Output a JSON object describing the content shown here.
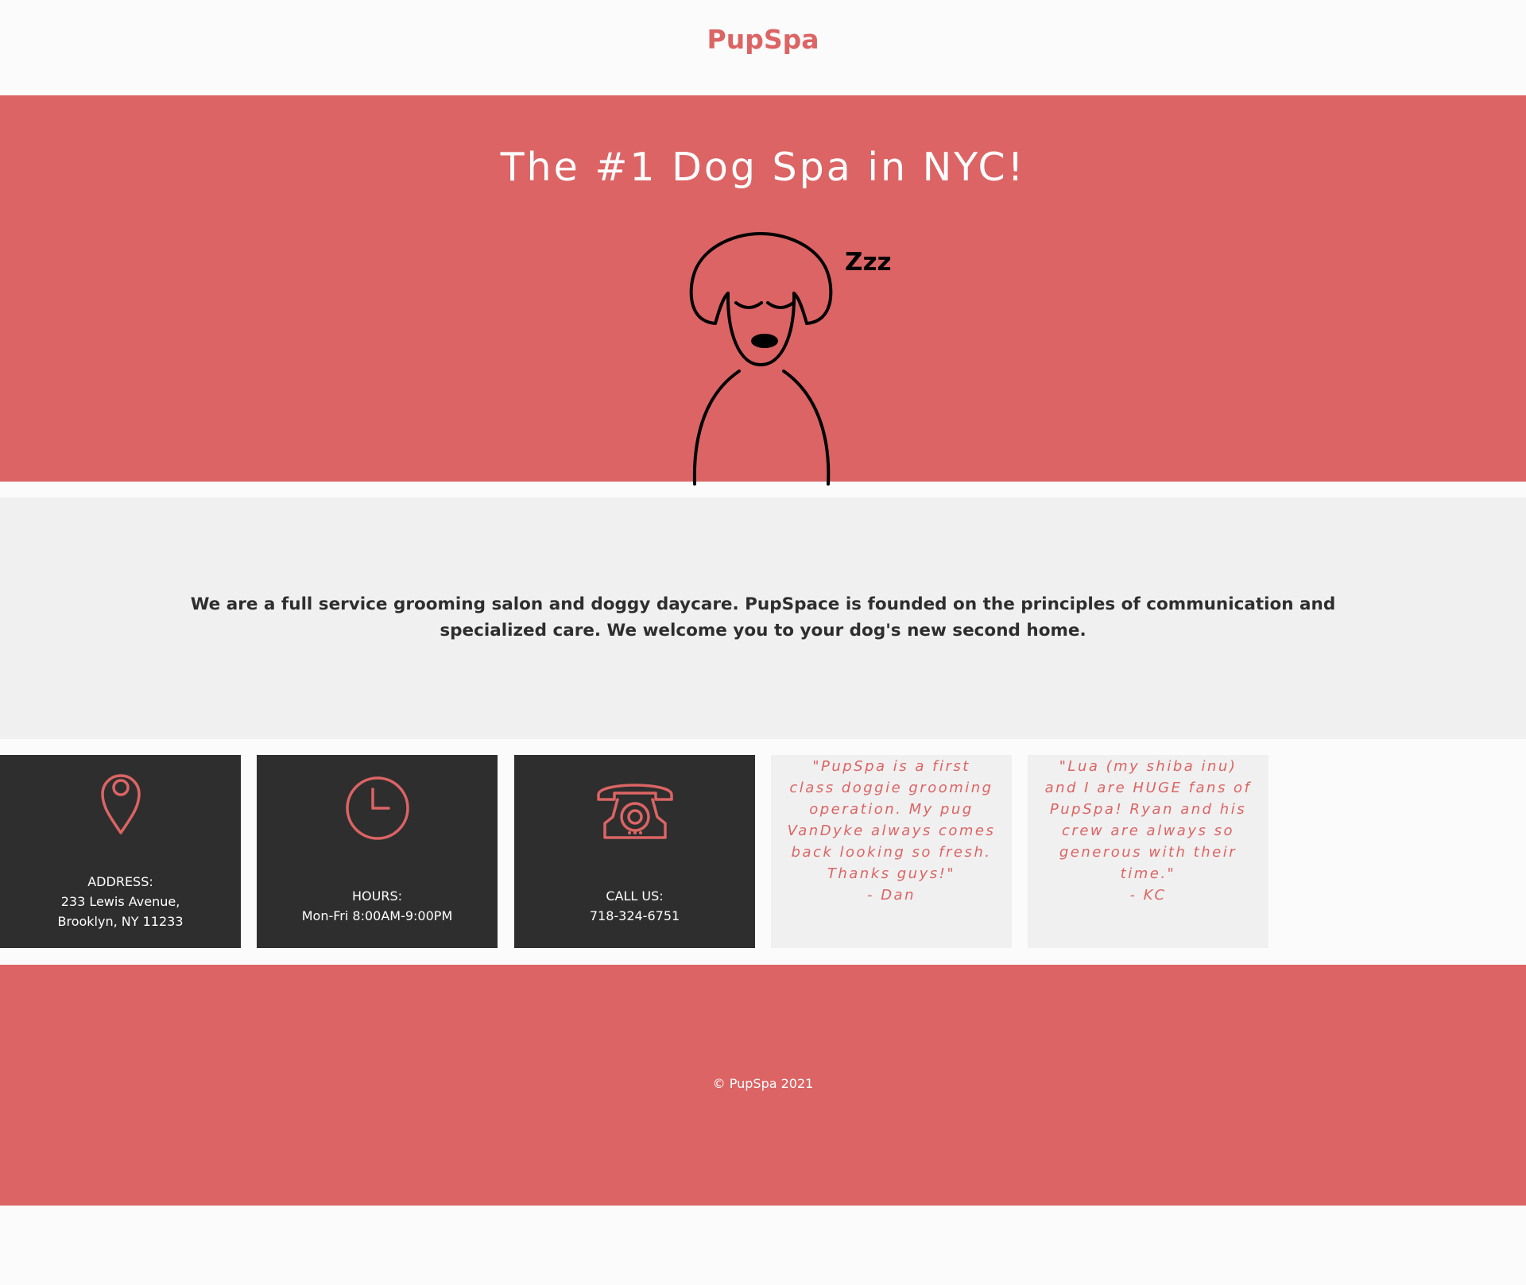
{
  "header": {
    "logo": "PupSpa"
  },
  "hero": {
    "title": "The #1 Dog Spa in NYC!",
    "illustration_icon": "sleeping-dog-icon",
    "sleep_text": "Zzz"
  },
  "about": {
    "text": "We are a full service grooming salon and doggy daycare. PupSpace is founded on the principles of communication and specialized care. We welcome you to your dog's new second home."
  },
  "info_cards": [
    {
      "icon": "location-pin-icon",
      "label": "ADDRESS:",
      "line1": "233 Lewis Avenue,",
      "line2": "Brooklyn, NY 11233"
    },
    {
      "icon": "clock-icon",
      "label": "HOURS:",
      "line1": "Mon-Fri 8:00AM-9:00PM"
    },
    {
      "icon": "telephone-icon",
      "label": "CALL US:",
      "line1": "718-324-6751"
    }
  ],
  "testimonials": [
    {
      "quote": "\"PupSpa is a first class doggie grooming operation. My pug VanDyke always comes back looking so fresh. Thanks guys!\"",
      "author": "- Dan"
    },
    {
      "quote": "\"Lua (my shiba inu) and I are HUGE fans of PupSpa! Ryan and his crew are always so generous with their time.\"",
      "author": "- KC"
    }
  ],
  "footer": {
    "copyright": "© PupSpa 2021"
  },
  "colors": {
    "accent": "#dc6464",
    "dark": "#2e2e2e",
    "light_gray": "#f0f0f0",
    "white": "#ffffff"
  }
}
